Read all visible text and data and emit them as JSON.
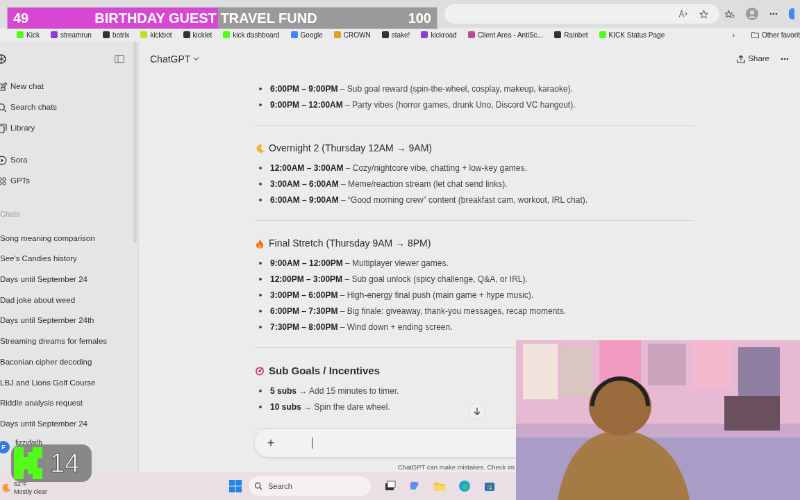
{
  "goal_overlay": {
    "current": "49",
    "title": "BIRTHDAY GUEST TRAVEL FUND",
    "target": "100",
    "level": 0.49
  },
  "bookmarks": [
    {
      "label": "Kick",
      "kind": "kick"
    },
    {
      "label": "streamrun",
      "kind": "purple"
    },
    {
      "label": "botrix",
      "kind": "dark"
    },
    {
      "label": "kickbot",
      "kind": "lime"
    },
    {
      "label": "kicklet",
      "kind": "dark"
    },
    {
      "label": "kick dashboard",
      "kind": "kick"
    },
    {
      "label": "Google",
      "kind": "google"
    },
    {
      "label": "CROWN",
      "kind": "crown"
    },
    {
      "label": "stake!",
      "kind": "dark"
    },
    {
      "label": "kickroad",
      "kind": "purple"
    },
    {
      "label": "Client Area - AntiSc...",
      "kind": "bars"
    },
    {
      "label": "Rainbet",
      "kind": "dark"
    },
    {
      "label": "KICK Status Page",
      "kind": "kick"
    }
  ],
  "bookmarks_more": "›",
  "other_favorites": "Other favorit",
  "sidebar": {
    "items": [
      {
        "label": "New chat",
        "kind": "new"
      },
      {
        "label": "Search chats",
        "kind": "search"
      },
      {
        "label": "Library",
        "kind": "library"
      },
      {
        "label": "Sora",
        "kind": "sora"
      },
      {
        "label": "GPTs",
        "kind": "gpts"
      }
    ],
    "chats_heading": "Chats",
    "chats": [
      "Song meaning comparison",
      "See's Candies history",
      "Days until September 24",
      "Dad joke about weed",
      "Days until September 24th",
      "Streaming dreams for females",
      "Baconian cipher decoding",
      "LBJ and Lions Golf Course",
      "Riddle analysis request",
      "Days until September 24"
    ],
    "user": {
      "initial": "F",
      "name": "fizzyfaith"
    }
  },
  "header": {
    "model": "ChatGPT",
    "share": "Share"
  },
  "sections": [
    {
      "items": [
        "**6:00PM – 9:00PM** – Sub goal reward (spin-the-wheel, cosplay, makeup, karaoke).",
        "**9:00PM – 12:00AM** – Party vibes (horror games, drunk Uno, Discord VC hangout)."
      ]
    },
    {
      "kind": "moon",
      "title": "Overnight 2 (Thursday 12AM → 9AM)",
      "items": [
        "**12:00AM – 3:00AM** – Cozy/nightcore vibe, chatting + low-key games.",
        "**3:00AM – 6:00AM** – Meme/reaction stream (let chat send links).",
        "**6:00AM – 9:00AM** – “Good morning crew” content (breakfast cam, workout, IRL chat)."
      ]
    },
    {
      "kind": "fire",
      "title": "Final Stretch (Thursday 9AM → 8PM)",
      "items": [
        "**9:00AM – 12:00PM** – Multiplayer viewer games.",
        "**12:00PM – 3:00PM** – Sub goal unlock (spicy challenge, Q&A, or IRL).",
        "**3:00PM – 6:00PM** – High-energy final push (main game + hype music).",
        "**6:00PM – 7:30PM** – Big finale: giveaway, thank-you messages, recap moments.",
        "**7:30PM – 8:00PM** – Wind down + ending screen."
      ]
    },
    {
      "kind": "target",
      "title": "Sub Goals / Incentives",
      "large": true,
      "items": [
        "**5 subs** → Add 15 minutes to timer.",
        "**10 subs** → Spin the dare wheel."
      ]
    }
  ],
  "composer": {
    "add": "+"
  },
  "disclaimer": "ChatGPT can make mistakes. Check im",
  "kick_overlay": {
    "count": "14"
  },
  "taskbar": {
    "temperature": "62°F",
    "weather": "Mostly clear",
    "search": "Search"
  }
}
